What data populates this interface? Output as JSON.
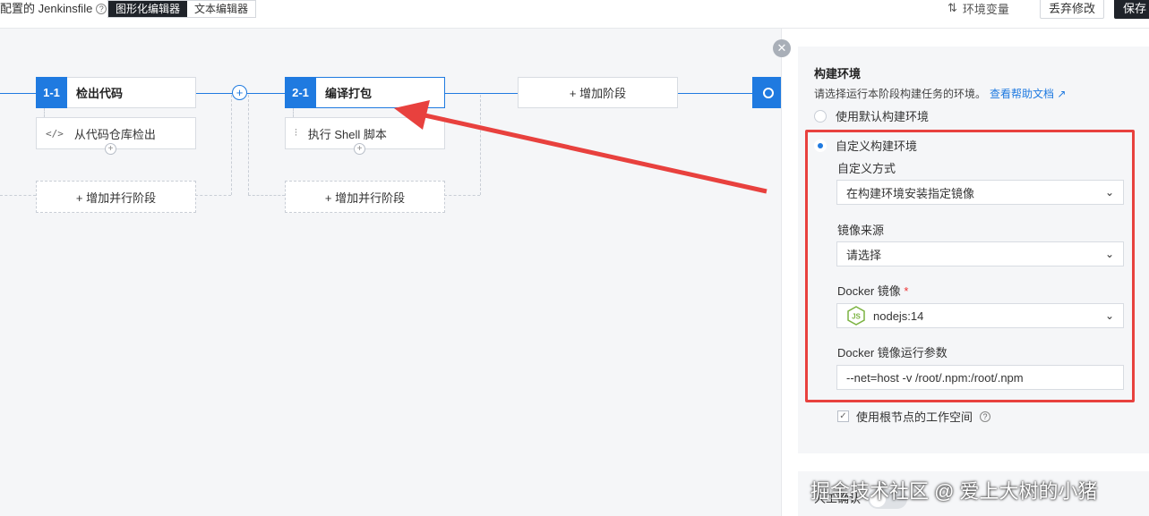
{
  "topbar": {
    "title": "配置的 Jenkinsfile",
    "mode_graphic": "图形化编辑器",
    "mode_text": "文本编辑器",
    "env_vars": "环境变量",
    "discard": "丢弃修改",
    "save": "保存"
  },
  "pipeline": {
    "stages": [
      {
        "num": "1-1",
        "name": "检出代码",
        "step": "从代码仓库检出",
        "step_icon": "code-icon"
      },
      {
        "num": "2-1",
        "name": "编译打包",
        "step": "执行 Shell 脚本",
        "step_icon": "settings-sliders-icon"
      }
    ],
    "add_parallel": "+ 增加并行阶段",
    "add_stage": "+ 增加阶段"
  },
  "panel": {
    "section_title": "构建环境",
    "section_desc": "请选择运行本阶段构建任务的环境。",
    "help_link": "查看帮助文档",
    "radio_default": "使用默认构建环境",
    "radio_custom": "自定义构建环境",
    "custom_mode_label": "自定义方式",
    "custom_mode_value": "在构建环境安装指定镜像",
    "image_source_label": "镜像来源",
    "image_source_value": "请选择",
    "docker_image_label": "Docker 镜像",
    "docker_image_value": "nodejs:14",
    "docker_args_label": "Docker 镜像运行参数",
    "docker_args_value": "--net=host -v /root/.npm:/root/.npm",
    "use_root_workspace": "使用根节点的工作空间",
    "manual_confirm": "人工确认"
  },
  "watermark": "掘金技术社区 @ 爱上大树的小猪",
  "colors": {
    "accent": "#1f7ae0",
    "annotation": "#e8413e"
  }
}
